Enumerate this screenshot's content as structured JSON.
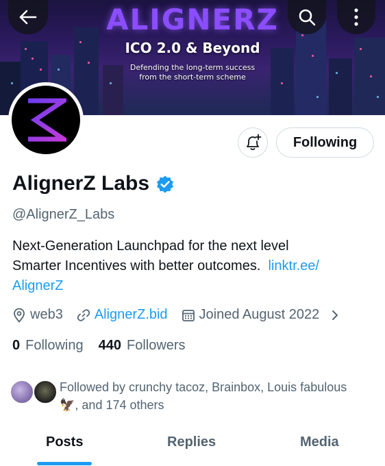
{
  "banner": {
    "brand": "ALIGNERZ",
    "tagline": "ICO 2.0 & Beyond",
    "sub_line1": "Defending the long-term success",
    "sub_line2": "from the short-term scheme"
  },
  "nav": {
    "back_icon": "arrow-left-icon",
    "search_icon": "search-icon",
    "more_icon": "more-vertical-icon"
  },
  "actions": {
    "notify_icon": "bell-plus-icon",
    "following_label": "Following"
  },
  "profile": {
    "name": "AlignerZ Labs",
    "handle": "@AlignerZ_Labs",
    "bio_line1": "Next-Generation Launchpad for the next level",
    "bio_line2": "Smarter Incentives with better outcomes.",
    "bio_link_part1": "linktr.ee/",
    "bio_link_part2": "AlignerZ",
    "location": "web3",
    "website": "AlignerZ.bid",
    "joined": "Joined August 2022"
  },
  "stats": {
    "following_count": "0",
    "following_label": "Following",
    "followers_count": "440",
    "followers_label": "Followers"
  },
  "followed_by": {
    "line1": "Followed by crunchy tacoz, Brainbox, Louis fabulous",
    "line2_emoji": "🦅",
    "line2": ", and 174 others"
  },
  "tabs": [
    "Posts",
    "Replies",
    "Media"
  ],
  "colors": {
    "accent": "#1d9bf0",
    "text": "#0f1419",
    "muted": "#536471",
    "brand_purple": "#8a4dff"
  }
}
